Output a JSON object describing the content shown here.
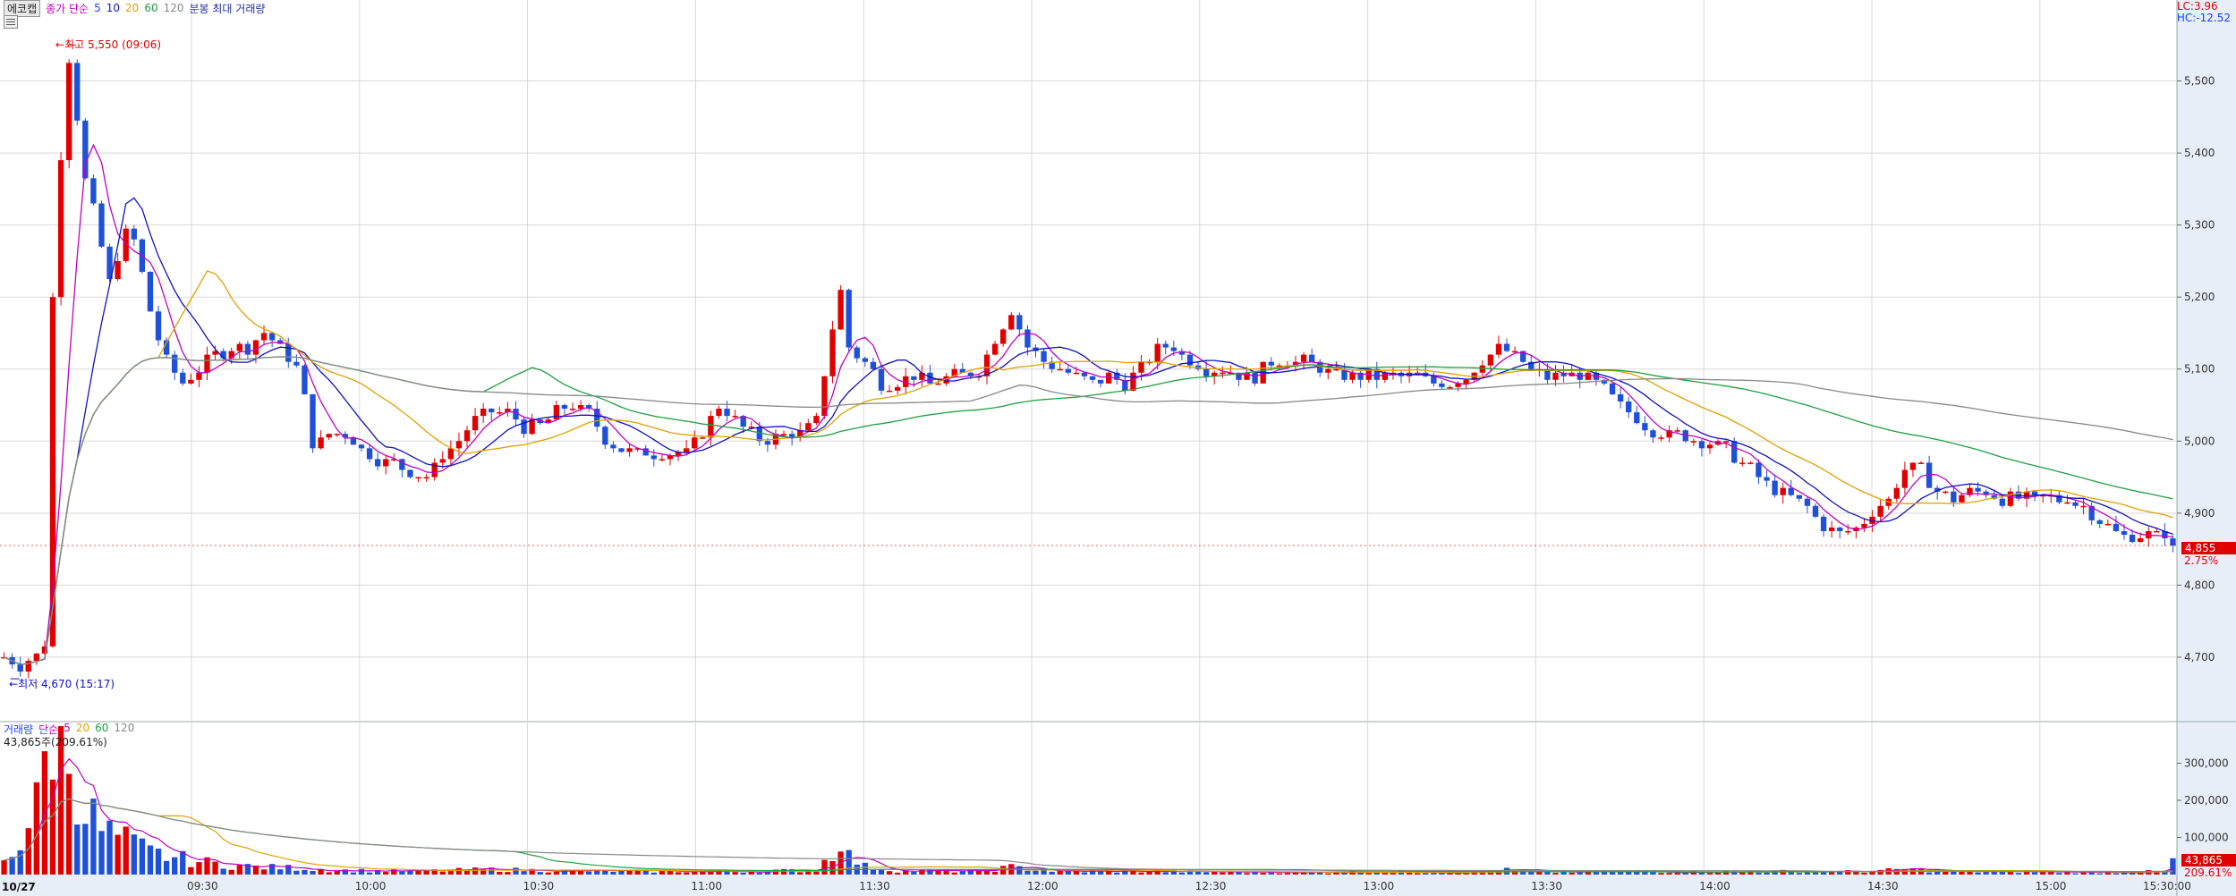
{
  "header": {
    "stock_name": "에코캡",
    "ma_label": "종가 단순",
    "ma_periods": [
      "5",
      "10",
      "20",
      "60",
      "120"
    ],
    "options": "분봉 최대 거래량"
  },
  "markers": {
    "high": "최고 5,550 (09:06)",
    "low": "최저 4,670 (15:17)"
  },
  "lc_hc": {
    "lc": "LC:3.96",
    "hc": "HC:-12.52"
  },
  "current": {
    "price": "4,855",
    "pct": "2.75%",
    "volume": "43,865",
    "volume_pct": "209.61%"
  },
  "volume_legend": {
    "title": "거래량",
    "ma_label": "단순",
    "periods": [
      "5",
      "20",
      "60",
      "120"
    ],
    "readout": "43,865주(209.61%)"
  },
  "date_label": "10/27",
  "icons": {
    "menu": "menu-icon",
    "arrow": "arrow-left-icon",
    "star": "star-icon"
  },
  "colors": {
    "up": "#e00000",
    "down": "#1e50d8",
    "ma5": "#c000c0",
    "ma10": "#1010c0",
    "ma20": "#e0a000",
    "ma60": "#20a040",
    "ma120": "#888888",
    "grid": "#d8d8d8",
    "axis_bg": "#e8eef8"
  },
  "chart_data": [
    {
      "type": "candlestick",
      "title": "",
      "xlabel": "",
      "ylabel": "",
      "x_ticks": [
        "09:30",
        "10:00",
        "10:30",
        "11:00",
        "11:30",
        "12:00",
        "12:30",
        "13:00",
        "13:30",
        "14:00",
        "14:30",
        "15:00",
        "15:30:00"
      ],
      "y_ticks": [
        "4,700",
        "4,800",
        "4,900",
        "5,000",
        "5,100",
        "5,200",
        "5,300",
        "5,400",
        "5,500"
      ],
      "ylim": [
        4613,
        5600
      ],
      "grid": true,
      "price_path": [
        [
          0,
          4700
        ],
        [
          2,
          4690
        ],
        [
          4,
          4700
        ],
        [
          5,
          4720
        ],
        [
          6,
          5200
        ],
        [
          7,
          5400
        ],
        [
          8,
          5530
        ],
        [
          9,
          5450
        ],
        [
          10,
          5360
        ],
        [
          11,
          5320
        ],
        [
          12,
          5270
        ],
        [
          13,
          5220
        ],
        [
          14,
          5260
        ],
        [
          15,
          5290
        ],
        [
          16,
          5280
        ],
        [
          17,
          5230
        ],
        [
          18,
          5180
        ],
        [
          19,
          5140
        ],
        [
          20,
          5110
        ],
        [
          22,
          5080
        ],
        [
          24,
          5100
        ],
        [
          26,
          5120
        ],
        [
          28,
          5130
        ],
        [
          30,
          5130
        ],
        [
          32,
          5150
        ],
        [
          34,
          5130
        ],
        [
          36,
          5100
        ],
        [
          37,
          5060
        ],
        [
          38,
          5000
        ],
        [
          39,
          5000
        ],
        [
          40,
          5010
        ],
        [
          42,
          5010
        ],
        [
          44,
          4990
        ],
        [
          46,
          4975
        ],
        [
          48,
          4970
        ],
        [
          50,
          4960
        ],
        [
          52,
          4950
        ],
        [
          54,
          4980
        ],
        [
          56,
          5000
        ],
        [
          58,
          5030
        ],
        [
          60,
          5040
        ],
        [
          62,
          5040
        ],
        [
          64,
          5020
        ],
        [
          66,
          5020
        ],
        [
          68,
          5040
        ],
        [
          70,
          5050
        ],
        [
          72,
          5040
        ],
        [
          74,
          5000
        ],
        [
          76,
          4990
        ],
        [
          78,
          4985
        ],
        [
          80,
          4980
        ],
        [
          82,
          4985
        ],
        [
          84,
          4985
        ],
        [
          86,
          5010
        ],
        [
          88,
          5050
        ],
        [
          90,
          5030
        ],
        [
          92,
          5010
        ],
        [
          94,
          5000
        ],
        [
          96,
          5010
        ],
        [
          98,
          5010
        ],
        [
          100,
          5030
        ],
        [
          102,
          5160
        ],
        [
          103,
          5210
        ],
        [
          104,
          5130
        ],
        [
          106,
          5110
        ],
        [
          108,
          5080
        ],
        [
          110,
          5080
        ],
        [
          112,
          5090
        ],
        [
          114,
          5080
        ],
        [
          116,
          5090
        ],
        [
          118,
          5090
        ],
        [
          120,
          5100
        ],
        [
          122,
          5140
        ],
        [
          124,
          5180
        ],
        [
          126,
          5130
        ],
        [
          128,
          5110
        ],
        [
          130,
          5100
        ],
        [
          132,
          5090
        ],
        [
          134,
          5080
        ],
        [
          136,
          5090
        ],
        [
          138,
          5080
        ],
        [
          140,
          5100
        ],
        [
          142,
          5130
        ],
        [
          144,
          5130
        ],
        [
          146,
          5110
        ],
        [
          148,
          5100
        ],
        [
          150,
          5100
        ],
        [
          152,
          5090
        ],
        [
          154,
          5090
        ],
        [
          156,
          5110
        ],
        [
          158,
          5110
        ],
        [
          160,
          5110
        ],
        [
          162,
          5100
        ],
        [
          164,
          5090
        ],
        [
          166,
          5090
        ],
        [
          168,
          5090
        ],
        [
          170,
          5090
        ],
        [
          172,
          5090
        ],
        [
          174,
          5090
        ],
        [
          176,
          5080
        ],
        [
          178,
          5080
        ],
        [
          180,
          5090
        ],
        [
          182,
          5110
        ],
        [
          184,
          5130
        ],
        [
          186,
          5120
        ],
        [
          188,
          5100
        ],
        [
          190,
          5090
        ],
        [
          192,
          5090
        ],
        [
          194,
          5090
        ],
        [
          196,
          5080
        ],
        [
          198,
          5060
        ],
        [
          200,
          5040
        ],
        [
          202,
          5020
        ],
        [
          204,
          5010
        ],
        [
          206,
          5010
        ],
        [
          208,
          5000
        ],
        [
          210,
          5000
        ],
        [
          212,
          4990
        ],
        [
          214,
          4970
        ],
        [
          216,
          4950
        ],
        [
          218,
          4930
        ],
        [
          220,
          4920
        ],
        [
          222,
          4910
        ],
        [
          224,
          4880
        ],
        [
          226,
          4870
        ],
        [
          228,
          4880
        ],
        [
          230,
          4900
        ],
        [
          232,
          4920
        ],
        [
          234,
          4960
        ],
        [
          236,
          4960
        ],
        [
          238,
          4930
        ],
        [
          240,
          4920
        ],
        [
          242,
          4930
        ],
        [
          244,
          4930
        ],
        [
          246,
          4920
        ],
        [
          248,
          4920
        ],
        [
          250,
          4920
        ],
        [
          252,
          4920
        ],
        [
          254,
          4920
        ],
        [
          256,
          4910
        ],
        [
          258,
          4890
        ],
        [
          260,
          4870
        ],
        [
          262,
          4870
        ],
        [
          264,
          4870
        ],
        [
          266,
          4870
        ],
        [
          267,
          4855
        ]
      ],
      "high": 5550,
      "low": 4670,
      "close": 4855
    },
    {
      "type": "bar",
      "title": "거래량",
      "y_ticks": [
        "100,000",
        "200,000",
        "300,000"
      ],
      "ylim": [
        0,
        400000
      ],
      "volume_path": [
        [
          0,
          40000
        ],
        [
          2,
          90000
        ],
        [
          4,
          180000
        ],
        [
          5,
          300000
        ],
        [
          6,
          400000
        ],
        [
          7,
          360000
        ],
        [
          8,
          320000
        ],
        [
          9,
          260000
        ],
        [
          10,
          180000
        ],
        [
          12,
          120000
        ],
        [
          14,
          100000
        ],
        [
          16,
          80000
        ],
        [
          18,
          60000
        ],
        [
          20,
          50000
        ],
        [
          24,
          35000
        ],
        [
          28,
          25000
        ],
        [
          32,
          20000
        ],
        [
          36,
          18000
        ],
        [
          40,
          12000
        ],
        [
          50,
          9000
        ],
        [
          60,
          14000
        ],
        [
          70,
          10000
        ],
        [
          80,
          9000
        ],
        [
          90,
          8000
        ],
        [
          100,
          12000
        ],
        [
          102,
          60000
        ],
        [
          103,
          110000
        ],
        [
          104,
          50000
        ],
        [
          106,
          22000
        ],
        [
          110,
          10000
        ],
        [
          120,
          9000
        ],
        [
          124,
          20000
        ],
        [
          130,
          8000
        ],
        [
          140,
          9000
        ],
        [
          150,
          7000
        ],
        [
          160,
          6000
        ],
        [
          170,
          7000
        ],
        [
          180,
          6000
        ],
        [
          184,
          14000
        ],
        [
          190,
          6000
        ],
        [
          200,
          8000
        ],
        [
          210,
          7000
        ],
        [
          220,
          9000
        ],
        [
          230,
          8000
        ],
        [
          234,
          15000
        ],
        [
          240,
          8000
        ],
        [
          250,
          7000
        ],
        [
          260,
          6000
        ],
        [
          266,
          9000
        ],
        [
          267,
          43865
        ]
      ]
    }
  ]
}
